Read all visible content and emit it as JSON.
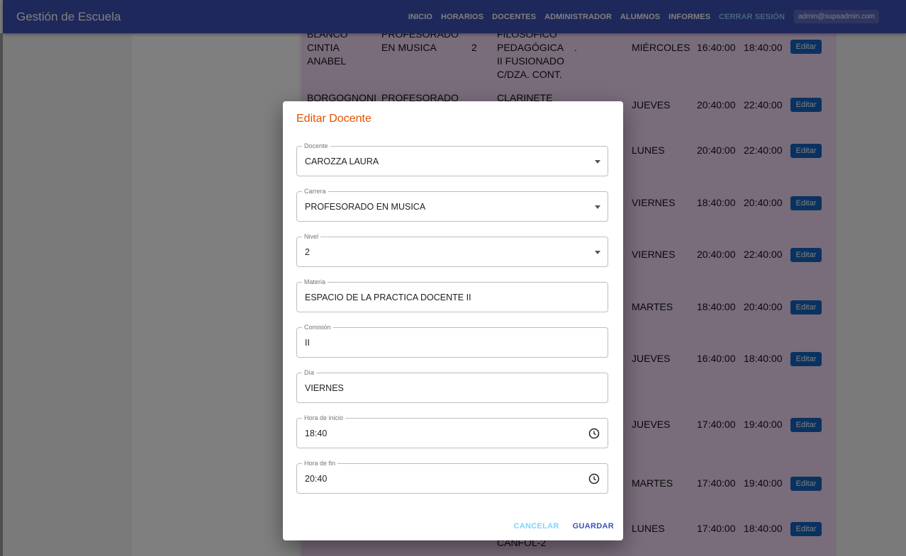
{
  "app": {
    "title": "Gestión de Escuela",
    "nav": [
      "INICIO",
      "HORARIOS",
      "DOCENTES",
      "ADMINISTRADOR",
      "ALUMNOS",
      "INFORMES"
    ],
    "logout": "CERRAR SESIÓN",
    "user": "admin@supaadmin.com"
  },
  "table": {
    "edit_label": "Editar",
    "rows": [
      {
        "name": "BLANCO CINTIA ANABEL",
        "carrera": "PROFESORADO EN MUSICA",
        "nivel": "2",
        "materia": "FILOSOFICO PEDAGÓGICA II FUSIONADO C/DZA. CONT.",
        "comision": ".",
        "dia": "MIÉRCOLES",
        "inicio": "16:40:00",
        "fin": "18:40:00"
      },
      {
        "name": "BORGOGNONI",
        "carrera": "PROFESORADO",
        "nivel": "",
        "materia": "CLARINETE",
        "comision": "",
        "dia": "JUEVES",
        "inicio": "20:40:00",
        "fin": "22:40:00"
      },
      {
        "name": "",
        "carrera": "",
        "nivel": "",
        "materia": "",
        "comision": "",
        "dia": "LUNES",
        "inicio": "20:40:00",
        "fin": "22:40:00"
      },
      {
        "name": "",
        "carrera": "",
        "nivel": "",
        "materia": "",
        "comision": "",
        "dia": "VIERNES",
        "inicio": "18:40:00",
        "fin": "20:40:00"
      },
      {
        "name": "",
        "carrera": "",
        "nivel": "",
        "materia": "",
        "comision": "",
        "dia": "VIERNES",
        "inicio": "20:40:00",
        "fin": "22:40:00"
      },
      {
        "name": "",
        "carrera": "",
        "nivel": "",
        "materia": "",
        "comision": "",
        "dia": "MARTES",
        "inicio": "18:40:00",
        "fin": "20:40:00"
      },
      {
        "name": "",
        "carrera": "",
        "nivel": "",
        "materia": "",
        "comision": "",
        "dia": "JUEVES",
        "inicio": "16:40:00",
        "fin": "18:40:00"
      },
      {
        "name": "",
        "carrera": "",
        "nivel": "",
        "materia": "",
        "comision": "",
        "dia": "JUEVES",
        "inicio": "17:40:00",
        "fin": "19:40:00"
      },
      {
        "name": "",
        "carrera": "",
        "nivel": "",
        "materia": "",
        "comision": "",
        "dia": "MARTES",
        "inicio": "17:40:00",
        "fin": "19:40:00"
      },
      {
        "name": "",
        "carrera": "",
        "nivel": "",
        "materia": "CANFOL-2",
        "comision": "",
        "dia": "LUNES",
        "inicio": "17:40:00",
        "fin": "18:40:00"
      }
    ]
  },
  "dialog": {
    "title": "Editar Docente",
    "fields": [
      {
        "label": "Docente",
        "value": "CAROZZA LAURA",
        "type": "select"
      },
      {
        "label": "Carrera",
        "value": "PROFESORADO EN MUSICA",
        "type": "select"
      },
      {
        "label": "Nivel",
        "value": "2",
        "type": "select"
      },
      {
        "label": "Materia",
        "value": "ESPACIO DE LA PRACTICA DOCENTE II",
        "type": "text"
      },
      {
        "label": "Comisión",
        "value": "II",
        "type": "text"
      },
      {
        "label": "Día",
        "value": "VIERNES",
        "type": "text"
      },
      {
        "label": "Hora de inicio",
        "value": "18:40",
        "type": "time"
      },
      {
        "label": "Hora de fin",
        "value": "20:40",
        "type": "time"
      }
    ],
    "cancel": "CANCELAR",
    "save": "GUARDAR"
  }
}
